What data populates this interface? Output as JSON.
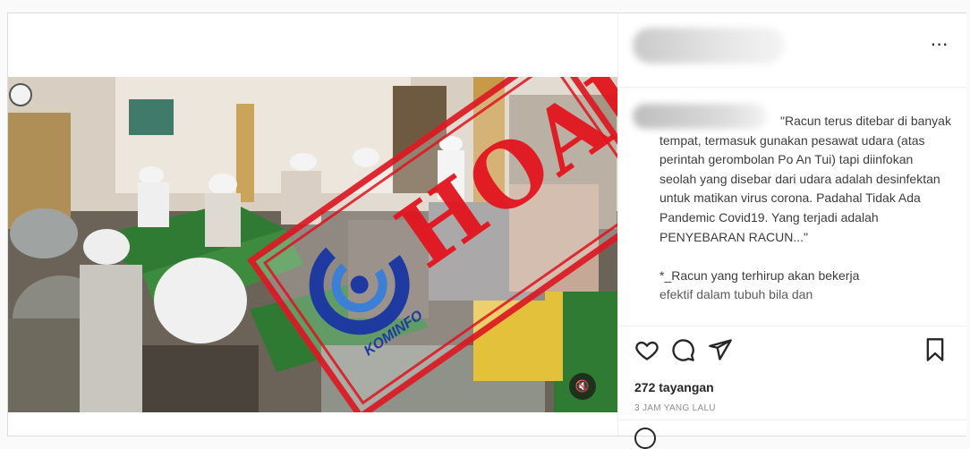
{
  "post": {
    "more_icon": "more-horizontal-icon",
    "caption": "\"Racun terus ditebar di banyak tempat, termasuk gunakan pesawat udara (atas perintah gerombolan Po An Tui) tapi diinfokan seolah yang disebar dari udara adalah desinfektan untuk matikan virus corona. Padahal Tidak Ada Pandemic Covid19. Yang terjadi adalah PENYEBARAN RACUN...\"\n\n*_Racun yang terhirup akan bekerja",
    "caption_cutoff": "efektif dalam tubuh bila dan",
    "views": "272 tayangan",
    "time": "3 JAM YANG LALU",
    "actions": {
      "like_icon": "heart-icon",
      "comment_icon": "comment-icon",
      "share_icon": "send-icon",
      "save_icon": "bookmark-icon"
    }
  },
  "media": {
    "stamp_text": "HOAKS",
    "logo_text": "KOMINFO",
    "mute_icon": "mute-icon",
    "stamp_color": "#e0141e",
    "logo_color": "#1e3aa0"
  }
}
